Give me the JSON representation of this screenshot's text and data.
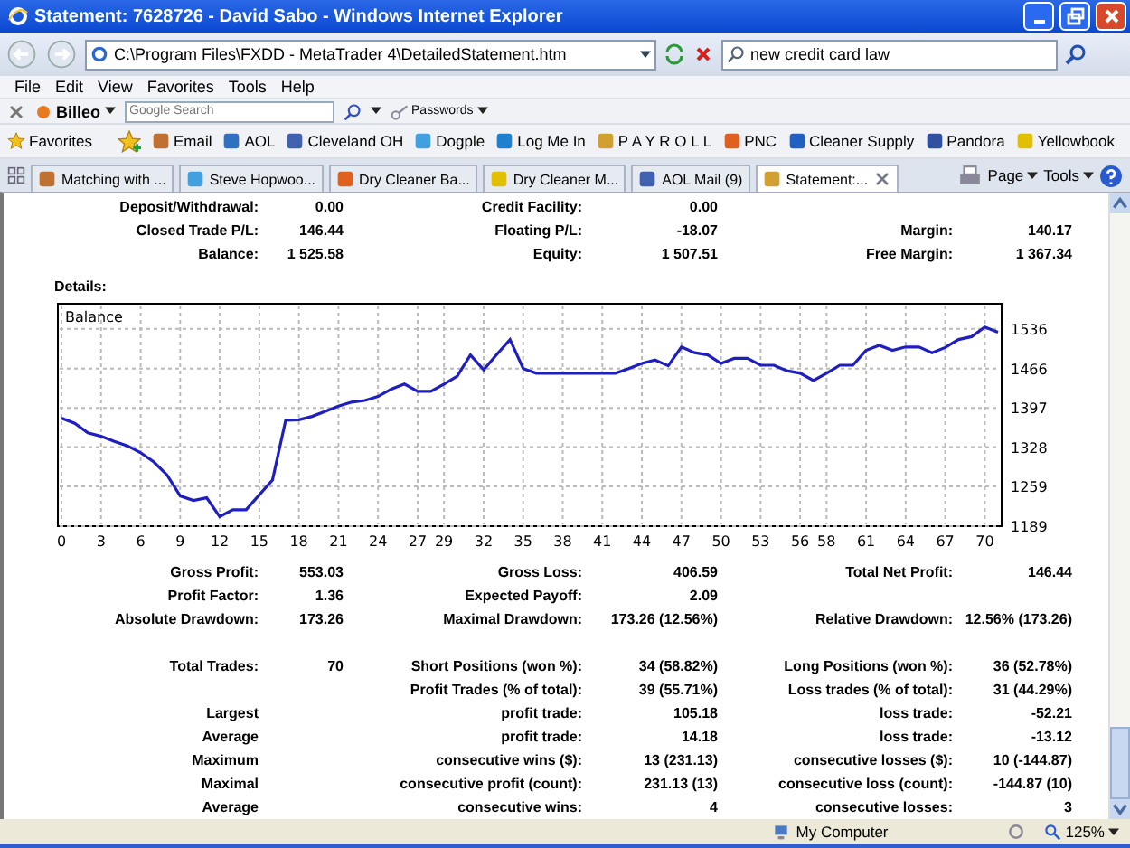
{
  "window": {
    "title": "Statement: 7628726 - David Sabo - Windows Internet Explorer"
  },
  "address_bar": {
    "url": "C:\\Program Files\\FXDD - MetaTrader 4\\DetailedStatement.htm",
    "search_value": "new credit card law"
  },
  "menu": [
    "File",
    "Edit",
    "View",
    "Favorites",
    "Tools",
    "Help"
  ],
  "billeo_bar": {
    "brand": "Billeo",
    "search_placeholder": "Google Search",
    "passwords": "Passwords"
  },
  "favorites_bar": {
    "label": "Favorites",
    "items": [
      "Email",
      "AOL",
      "Cleveland OH",
      "Dogple",
      "Log Me In",
      "P A Y R O L L",
      "PNC",
      "Cleaner Supply",
      "Pandora",
      "Yellowbook"
    ]
  },
  "tabs": [
    {
      "label": "Matching with ...",
      "selected": false
    },
    {
      "label": "Steve Hopwoo...",
      "selected": false
    },
    {
      "label": "Dry Cleaner Ba...",
      "selected": false
    },
    {
      "label": "Dry Cleaner M...",
      "selected": false
    },
    {
      "label": "AOL Mail (9)",
      "selected": false
    },
    {
      "label": "Statement:...",
      "selected": true
    }
  ],
  "command_bar": [
    "Page",
    "Tools"
  ],
  "summary": [
    {
      "left": {
        "label": "Deposit/Withdrawal:",
        "value": "0.00"
      },
      "middle": {
        "label": "Credit Facility:",
        "value": "0.00"
      }
    },
    {
      "left": {
        "label": "Closed Trade P/L:",
        "value": "146.44"
      },
      "middle": {
        "label": "Floating P/L:",
        "value": "-18.07"
      },
      "right": {
        "label": "Margin:",
        "value": "140.17"
      }
    },
    {
      "left": {
        "label": "Balance:",
        "value": "1 525.58"
      },
      "middle": {
        "label": "Equity:",
        "value": "1 507.51"
      },
      "right": {
        "label": "Free Margin:",
        "value": "1 367.34"
      }
    }
  ],
  "details_label": "Details:",
  "chart_data": {
    "type": "line",
    "grid": true,
    "xlim": [
      0,
      71
    ],
    "ylim": [
      1189,
      1580
    ],
    "xticks": [
      0,
      3,
      6,
      9,
      12,
      15,
      18,
      21,
      24,
      27,
      29,
      32,
      35,
      38,
      41,
      44,
      47,
      50,
      53,
      56,
      58,
      61,
      64,
      67,
      70
    ],
    "yticks": [
      1189,
      1259,
      1328,
      1397,
      1466,
      1536
    ],
    "x": [
      0,
      1,
      2,
      3,
      4,
      5,
      6,
      7,
      8,
      9,
      10,
      11,
      12,
      13,
      14,
      15,
      16,
      17,
      18,
      19,
      20,
      21,
      22,
      23,
      24,
      25,
      26,
      27,
      28,
      29,
      30,
      31,
      32,
      33,
      34,
      35,
      36,
      37,
      38,
      39,
      40,
      41,
      42,
      43,
      44,
      45,
      46,
      47,
      48,
      49,
      50,
      51,
      52,
      53,
      54,
      55,
      56,
      57,
      58,
      59,
      60,
      61,
      62,
      63,
      64,
      65,
      66,
      67,
      68,
      69,
      70,
      71
    ],
    "series": [
      {
        "name": "Balance",
        "color": "#1f1fbf",
        "values": [
          1379,
          1370,
          1353,
          1347,
          1338,
          1330,
          1318,
          1302,
          1279,
          1242,
          1234,
          1239,
          1206,
          1218,
          1218,
          1244,
          1270,
          1375,
          1376,
          1382,
          1391,
          1400,
          1407,
          1410,
          1417,
          1430,
          1439,
          1426,
          1426,
          1439,
          1453,
          1490,
          1464,
          1491,
          1517,
          1466,
          1458,
          1458,
          1458,
          1458,
          1458,
          1458,
          1458,
          1466,
          1475,
          1481,
          1471,
          1504,
          1494,
          1490,
          1475,
          1484,
          1484,
          1472,
          1472,
          1462,
          1458,
          1445,
          1458,
          1472,
          1472,
          1498,
          1507,
          1498,
          1504,
          1504,
          1494,
          1503,
          1517,
          1522,
          1539,
          1530
        ]
      }
    ]
  },
  "stats": [
    {
      "left": {
        "label": "Gross Profit:",
        "value": "553.03"
      },
      "middle": {
        "label": "Gross Loss:",
        "value": "406.59"
      },
      "right": {
        "label": "Total Net Profit:",
        "value": "146.44"
      }
    },
    {
      "left": {
        "label": "Profit Factor:",
        "value": "1.36"
      },
      "middle": {
        "label": "Expected Payoff:",
        "value": "2.09"
      }
    },
    {
      "left": {
        "label": "Absolute Drawdown:",
        "value": "173.26"
      },
      "middle": {
        "label": "Maximal Drawdown:",
        "value": "173.26 (12.56%)"
      },
      "right": {
        "label": "Relative Drawdown:",
        "value": "12.56% (173.26)"
      }
    },
    {
      "left": {
        "label": "Total Trades:",
        "value": "70"
      },
      "middle": {
        "label": "Short Positions (won %):",
        "value": "34 (58.82%)"
      },
      "right": {
        "label": "Long Positions (won %):",
        "value": "36 (52.78%)"
      }
    },
    {
      "middle": {
        "label": "Profit Trades (% of total):",
        "value": "39 (55.71%)"
      },
      "right": {
        "label": "Loss trades (% of total):",
        "value": "31 (44.29%)"
      }
    },
    {
      "left": {
        "label": "Largest"
      },
      "middle": {
        "label": "profit trade:",
        "value": "105.18"
      },
      "right": {
        "label": "loss trade:",
        "value": "-52.21"
      }
    },
    {
      "left": {
        "label": "Average"
      },
      "middle": {
        "label": "profit trade:",
        "value": "14.18"
      },
      "right": {
        "label": "loss trade:",
        "value": "-13.12"
      }
    },
    {
      "left": {
        "label": "Maximum"
      },
      "middle": {
        "label": "consecutive wins ($):",
        "value": "13 (231.13)"
      },
      "right": {
        "label": "consecutive losses ($):",
        "value": "10 (-144.87)"
      }
    },
    {
      "left": {
        "label": "Maximal"
      },
      "middle": {
        "label": "consecutive profit (count):",
        "value": "231.13 (13)"
      },
      "right": {
        "label": "consecutive loss (count):",
        "value": "-144.87 (10)"
      }
    },
    {
      "left": {
        "label": "Average"
      },
      "middle": {
        "label": "consecutive wins:",
        "value": "4"
      },
      "right": {
        "label": "consecutive losses:",
        "value": "3"
      }
    }
  ],
  "status_bar": {
    "zone": "My Computer",
    "zoom": "125%"
  }
}
